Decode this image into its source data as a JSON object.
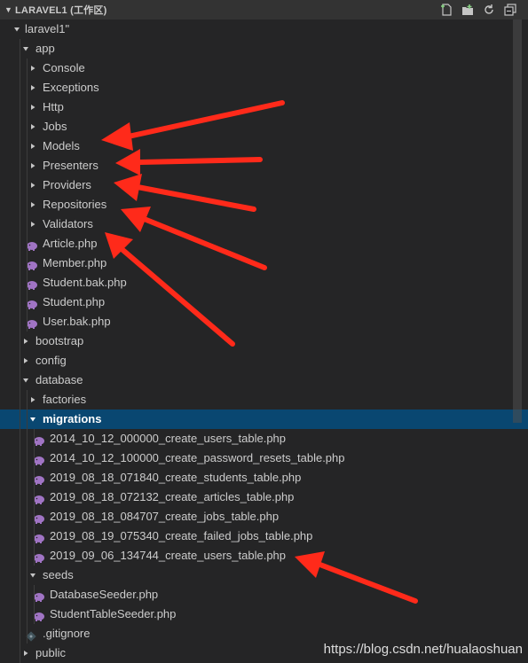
{
  "header": {
    "title": "LARAVEL1 (工作区)"
  },
  "tree": [
    {
      "label": "laravel1\"",
      "depth": 0,
      "type": "folder",
      "open": true
    },
    {
      "label": "app",
      "depth": 1,
      "type": "folder",
      "open": true
    },
    {
      "label": "Console",
      "depth": 2,
      "type": "folder",
      "open": false
    },
    {
      "label": "Exceptions",
      "depth": 2,
      "type": "folder",
      "open": false
    },
    {
      "label": "Http",
      "depth": 2,
      "type": "folder",
      "open": false
    },
    {
      "label": "Jobs",
      "depth": 2,
      "type": "folder",
      "open": false
    },
    {
      "label": "Models",
      "depth": 2,
      "type": "folder",
      "open": false
    },
    {
      "label": "Presenters",
      "depth": 2,
      "type": "folder",
      "open": false
    },
    {
      "label": "Providers",
      "depth": 2,
      "type": "folder",
      "open": false
    },
    {
      "label": "Repositories",
      "depth": 2,
      "type": "folder",
      "open": false
    },
    {
      "label": "Validators",
      "depth": 2,
      "type": "folder",
      "open": false
    },
    {
      "label": "Article.php",
      "depth": 2,
      "type": "php"
    },
    {
      "label": "Member.php",
      "depth": 2,
      "type": "php"
    },
    {
      "label": "Student.bak.php",
      "depth": 2,
      "type": "php"
    },
    {
      "label": "Student.php",
      "depth": 2,
      "type": "php"
    },
    {
      "label": "User.bak.php",
      "depth": 2,
      "type": "php"
    },
    {
      "label": "bootstrap",
      "depth": 1,
      "type": "folder",
      "open": false
    },
    {
      "label": "config",
      "depth": 1,
      "type": "folder",
      "open": false
    },
    {
      "label": "database",
      "depth": 1,
      "type": "folder",
      "open": true
    },
    {
      "label": "factories",
      "depth": 2,
      "type": "folder",
      "open": false
    },
    {
      "label": "migrations",
      "depth": 2,
      "type": "folder",
      "open": true,
      "selected": true
    },
    {
      "label": "2014_10_12_000000_create_users_table.php",
      "depth": 3,
      "type": "php"
    },
    {
      "label": "2014_10_12_100000_create_password_resets_table.php",
      "depth": 3,
      "type": "php"
    },
    {
      "label": "2019_08_18_071840_create_students_table.php",
      "depth": 3,
      "type": "php"
    },
    {
      "label": "2019_08_18_072132_create_articles_table.php",
      "depth": 3,
      "type": "php"
    },
    {
      "label": "2019_08_18_084707_create_jobs_table.php",
      "depth": 3,
      "type": "php"
    },
    {
      "label": "2019_08_19_075340_create_failed_jobs_table.php",
      "depth": 3,
      "type": "php"
    },
    {
      "label": "2019_09_06_134744_create_users_table.php",
      "depth": 3,
      "type": "php"
    },
    {
      "label": "seeds",
      "depth": 2,
      "type": "folder",
      "open": true
    },
    {
      "label": "DatabaseSeeder.php",
      "depth": 3,
      "type": "php"
    },
    {
      "label": "StudentTableSeeder.php",
      "depth": 3,
      "type": "php"
    },
    {
      "label": ".gitignore",
      "depth": 2,
      "type": "git"
    },
    {
      "label": "public",
      "depth": 1,
      "type": "folder",
      "open": false
    }
  ],
  "watermark": "https://blog.csdn.net/hualaoshuan",
  "colors": {
    "background": "#252526",
    "header": "#333333",
    "selection": "#094771",
    "php_icon": "#a074c4",
    "arrow": "#ff2a1a"
  },
  "icons": {
    "header_actions": [
      "new-file-icon",
      "new-folder-icon",
      "refresh-icon",
      "collapse-all-icon"
    ]
  }
}
